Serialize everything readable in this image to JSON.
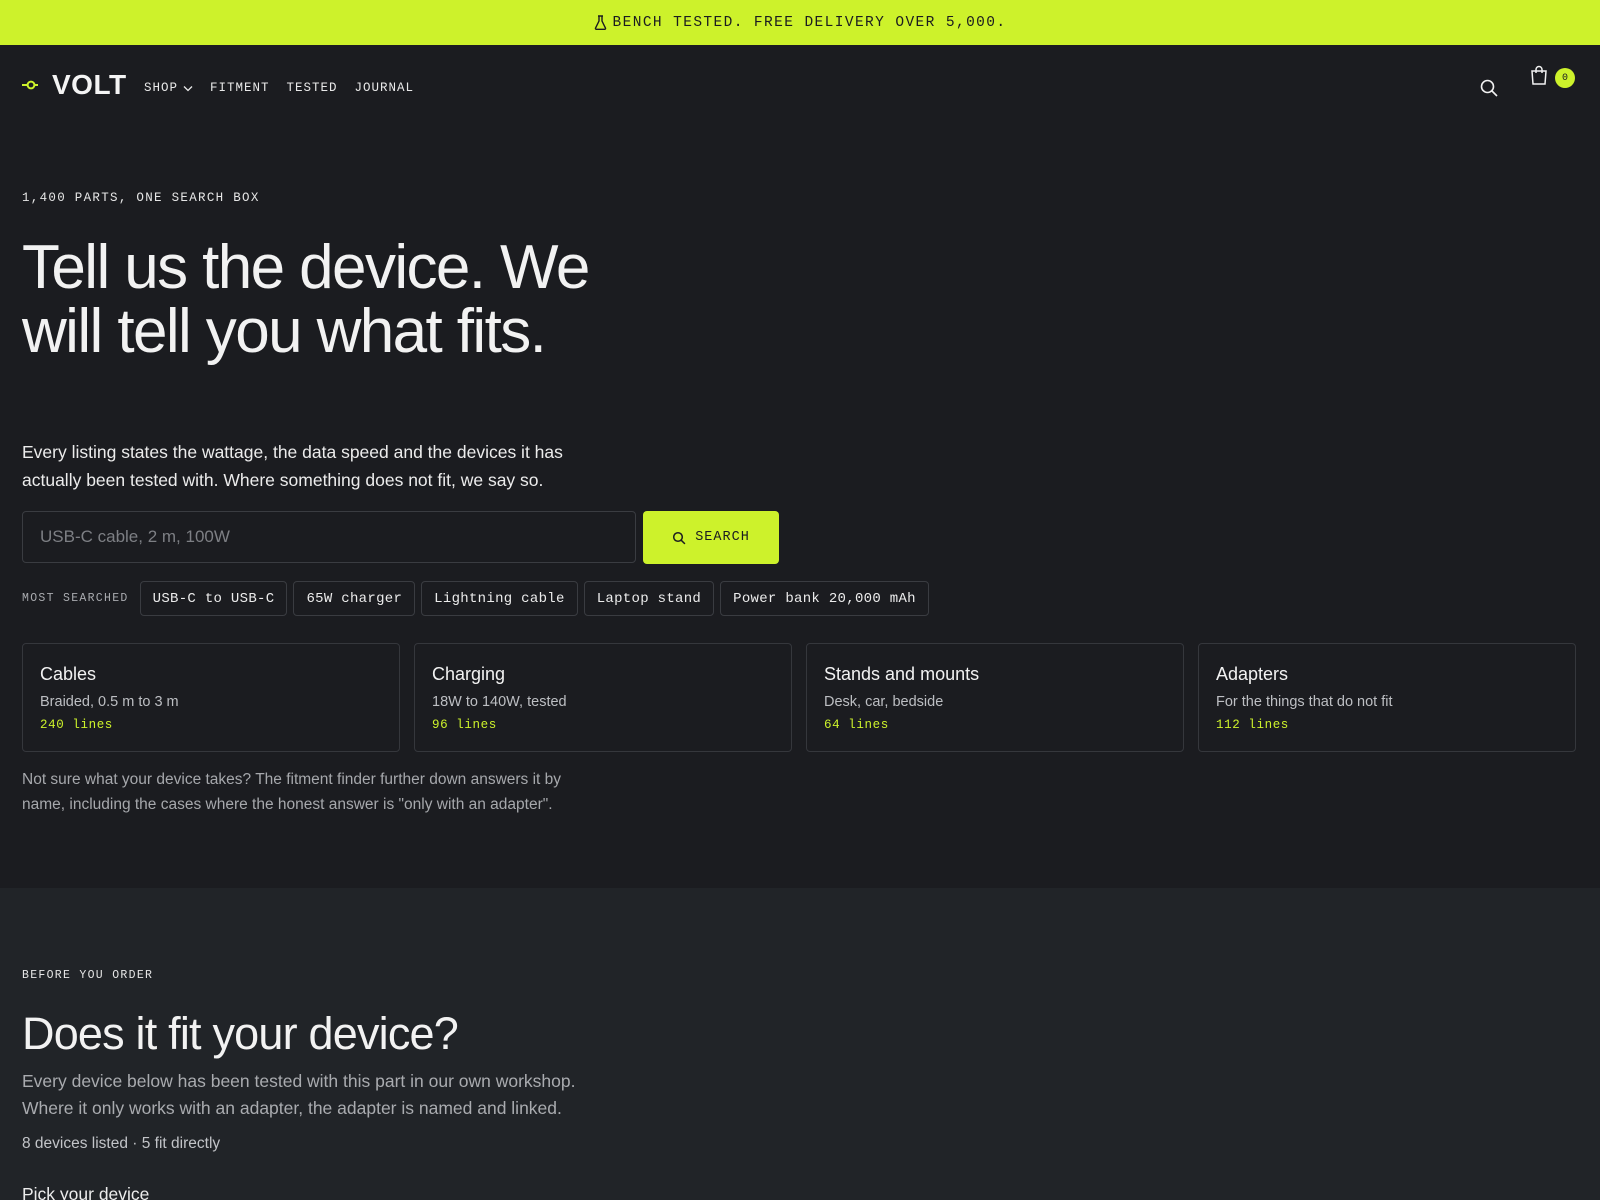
{
  "announcement": {
    "text": "BENCH TESTED. FREE DELIVERY OVER 5,000."
  },
  "brand": {
    "name": "VOLT",
    "accent": "#cdf22b",
    "background": "#1b1c20"
  },
  "nav": {
    "items": [
      {
        "label": "SHOP",
        "has_dropdown": true
      },
      {
        "label": "FITMENT"
      },
      {
        "label": "TESTED"
      },
      {
        "label": "JOURNAL"
      }
    ],
    "search_icon": "search-icon",
    "cart_icon": "shopping-bag-icon",
    "cart_count": "0"
  },
  "hero": {
    "eyebrow": "1,400 PARTS, ONE SEARCH BOX",
    "title": "Tell us the device. We will tell you what fits.",
    "subtitle": "Every listing states the wattage, the data speed and the devices it has actually been tested with. Where something does not fit, we say so.",
    "search": {
      "placeholder": "USB-C cable, 2 m, 100W",
      "button_label": "SEARCH"
    },
    "most_searched_label": "MOST SEARCHED",
    "most_searched": [
      "USB-C to USB-C",
      "65W charger",
      "Lightning cable",
      "Laptop stand",
      "Power bank 20,000 mAh"
    ],
    "categories": [
      {
        "title": "Cables",
        "desc": "Braided, 0.5 m to 3 m",
        "count": "240 lines"
      },
      {
        "title": "Charging",
        "desc": "18W to 140W, tested",
        "count": "96 lines"
      },
      {
        "title": "Stands and mounts",
        "desc": "Desk, car, bedside",
        "count": "64 lines"
      },
      {
        "title": "Adapters",
        "desc": "For the things that do not fit",
        "count": "112 lines"
      }
    ],
    "note": "Not sure what your device takes? The fitment finder further down answers it by name, including the cases where the honest answer is \"only with an adapter\"."
  },
  "fitment": {
    "eyebrow": "BEFORE YOU ORDER",
    "title": "Does it fit your device?",
    "subtitle": "Every device below has been tested with this part in our own workshop. Where it only works with an adapter, the adapter is named and linked.",
    "meta": "8 devices listed · 5 fit directly",
    "pick_label": "Pick your device"
  }
}
